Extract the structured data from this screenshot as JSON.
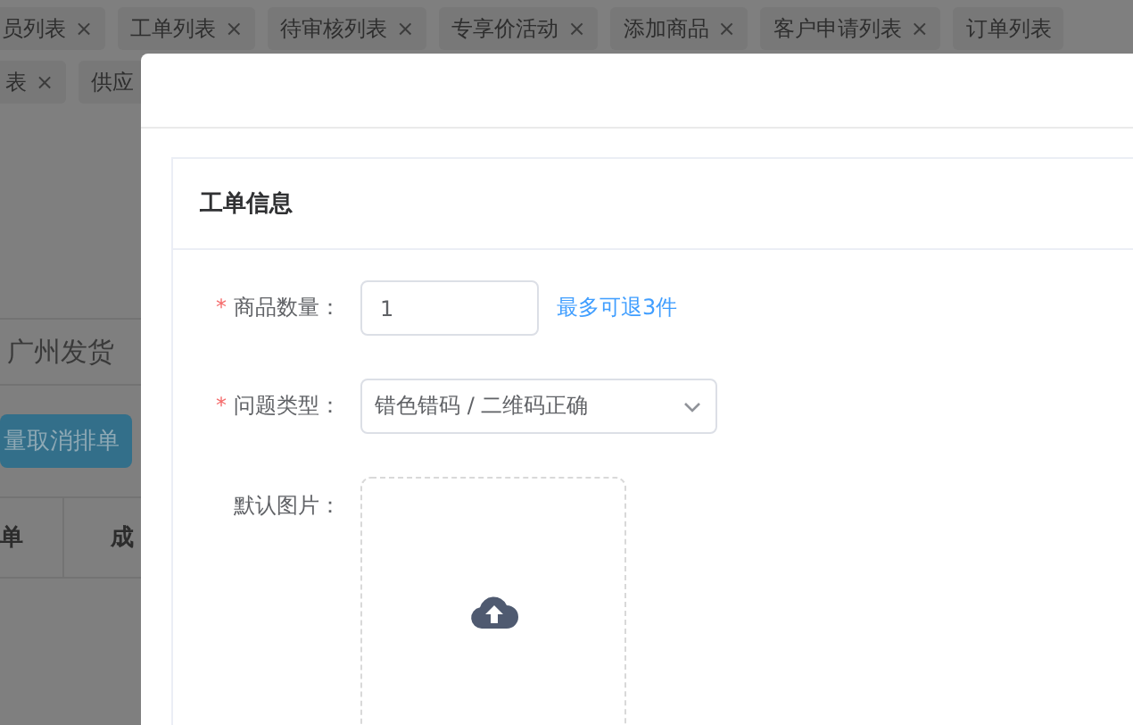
{
  "tabs_row_1": [
    {
      "label": "员列表",
      "close": "×"
    },
    {
      "label": "工单列表",
      "close": "×"
    },
    {
      "label": "待审核列表",
      "close": "×"
    },
    {
      "label": "专享价活动",
      "close": "×"
    },
    {
      "label": "添加商品",
      "close": "×"
    },
    {
      "label": "客户申请列表",
      "close": "×"
    },
    {
      "label": "订单列表"
    }
  ],
  "tabs_row_2": [
    {
      "label": "表",
      "close": "×"
    },
    {
      "label": "供应"
    }
  ],
  "background": {
    "filter_value": "广州发货",
    "button": "量取消排单",
    "columns": [
      "单",
      "成"
    ]
  },
  "dialog": {
    "card_title": "工单信息",
    "fields": [
      {
        "kind": "number",
        "label": "商品数量：",
        "required_mark": "*",
        "value": "1",
        "hint": "最多可退3件"
      },
      {
        "kind": "select",
        "label": "问题类型：",
        "required_mark": "*",
        "value": "错色错码 / 二维码正确"
      },
      {
        "kind": "upload",
        "label": "默认图片："
      }
    ]
  }
}
